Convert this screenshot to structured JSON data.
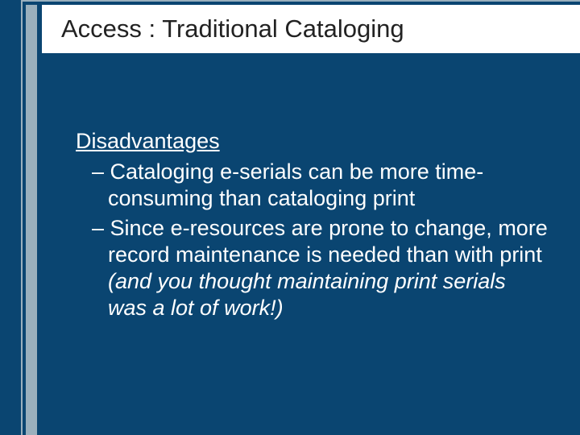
{
  "title": "Access : Traditional Cataloging",
  "section_heading": "Disadvantages",
  "bullets": [
    {
      "dash": "– ",
      "text": "Cataloging e-serials can be more time-consuming than cataloging print",
      "italic": ""
    },
    {
      "dash": "– ",
      "text": "Since e-resources are prone to change, more record maintenance is needed than with print ",
      "italic": "(and you thought maintaining print serials was a lot of work!)"
    }
  ]
}
